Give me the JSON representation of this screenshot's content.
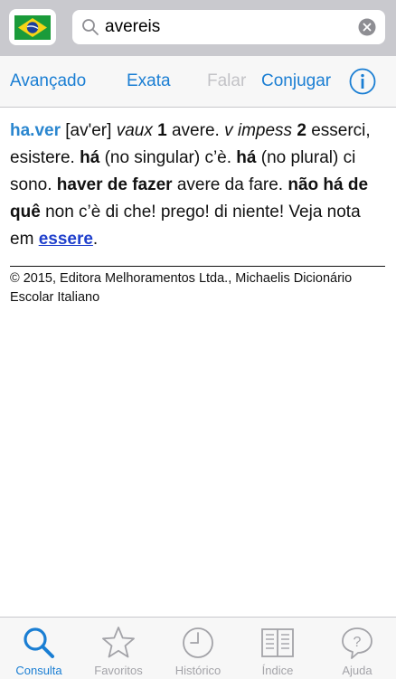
{
  "search": {
    "value": "avereis"
  },
  "toolbar": {
    "advanced": "Avançado",
    "exact": "Exata",
    "speak": "Falar",
    "conjugate": "Conjugar",
    "info_icon": "info-icon"
  },
  "entry": {
    "headword": "ha.ver",
    "pron": "[av'er]",
    "pos1": "vaux",
    "n1": "1",
    "t1": "avere.",
    "pos2": "v impess",
    "n2": "2",
    "t2": "esserci, esistere.",
    "p1": "há",
    "t3": "(no singular) c’è.",
    "p2": "há",
    "t4": "(no plural) ci sono.",
    "p3": "haver de fazer",
    "t5": "avere da fare.",
    "p4": "não há de quê",
    "t6": "non c’è di che! prego! di niente! Veja nota em",
    "link": "essere",
    "t7": "."
  },
  "copyright": "© 2015, Editora Melhoramentos Ltda., Michaelis Dicionário Escolar Italiano",
  "tabs": [
    {
      "label": "Consulta",
      "icon": "magnifier-icon",
      "active": true
    },
    {
      "label": "Favoritos",
      "icon": "star-icon",
      "active": false
    },
    {
      "label": "Histórico",
      "icon": "clock-icon",
      "active": false
    },
    {
      "label": "Índice",
      "icon": "book-icon",
      "active": false
    },
    {
      "label": "Ajuda",
      "icon": "question-icon",
      "active": false
    }
  ],
  "colors": {
    "accent": "#1a7ed3",
    "headword": "#2a86cf",
    "link": "#1f3fcc",
    "disabled": "#c3c3c7"
  }
}
